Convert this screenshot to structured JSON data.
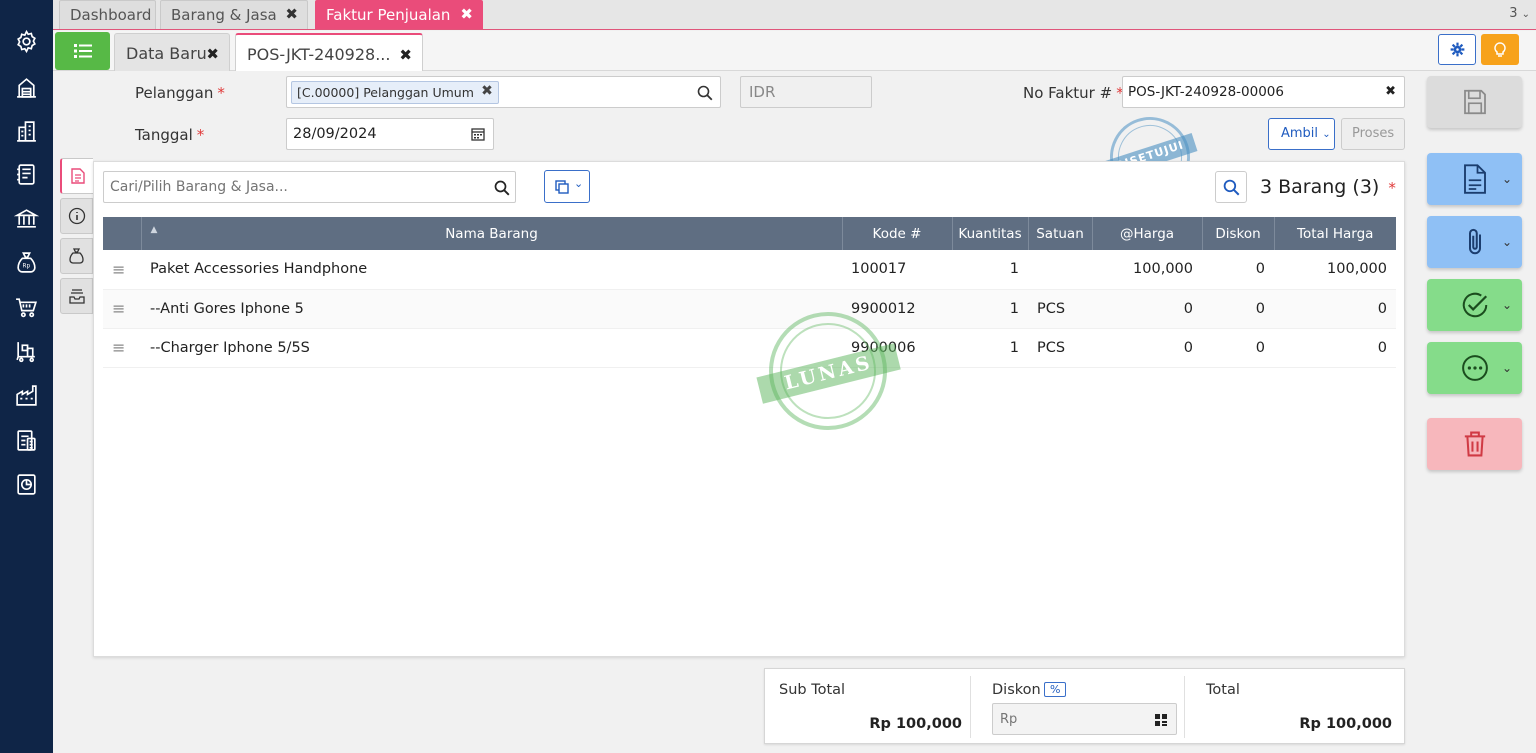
{
  "window_tabs": [
    {
      "label": "Dashboard",
      "closable": false,
      "active": false
    },
    {
      "label": "Barang & Jasa",
      "closable": true,
      "active": false
    },
    {
      "label": "Faktur Penjualan",
      "closable": true,
      "active": true
    }
  ],
  "tab_count": "3",
  "sub_tabs": [
    {
      "label": "Data Baru",
      "active": false
    },
    {
      "label": "POS-JKT-240928...",
      "active": true
    }
  ],
  "form": {
    "pelanggan_label": "Pelanggan",
    "pelanggan_value": "[C.00000] Pelanggan Umum",
    "currency": "IDR",
    "tanggal_label": "Tanggal",
    "tanggal_value": "28/09/2024",
    "no_faktur_label": "No Faktur #",
    "no_faktur_value": "POS-JKT-240928-00006",
    "required_mark": "*",
    "ambil_label": "Ambil",
    "proses_label": "Proses"
  },
  "items": {
    "search_placeholder": "Cari/Pilih Barang & Jasa...",
    "count_label": "3 Barang (3)",
    "columns": [
      "Nama Barang",
      "Kode #",
      "Kuantitas",
      "Satuan",
      "@Harga",
      "Diskon",
      "Total Harga"
    ],
    "rows": [
      {
        "nama": "Paket Accessories Handphone",
        "kode": "100017",
        "qty": "1",
        "satuan": "",
        "harga": "100,000",
        "diskon": "0",
        "total": "100,000"
      },
      {
        "nama": "--Anti Gores Iphone 5",
        "kode": "9900012",
        "qty": "1",
        "satuan": "PCS",
        "harga": "0",
        "diskon": "0",
        "total": "0"
      },
      {
        "nama": "--Charger Iphone 5/5S",
        "kode": "9900006",
        "qty": "1",
        "satuan": "PCS",
        "harga": "0",
        "diskon": "0",
        "total": "0"
      }
    ]
  },
  "stamps": {
    "approved": "DISETUJUI",
    "paid": "LUNAS"
  },
  "summary": {
    "subtotal_label": "Sub Total",
    "subtotal_value": "Rp 100,000",
    "diskon_label": "Diskon",
    "diskon_unit": "%",
    "diskon_placeholder": "Rp",
    "total_label": "Total",
    "total_value": "Rp 100,000"
  },
  "colors": {
    "sidebar": "#0f2547",
    "accent_pink": "#ea4c7a",
    "menu_green": "#57b946",
    "header_gray": "#5f6e82",
    "stamp_green": "#59b35a",
    "stamp_blue": "#4a90c2"
  },
  "sidebar_icons": [
    "gear-icon",
    "warehouse-icon",
    "building-icon",
    "ledger-icon",
    "bank-icon",
    "money-bag-icon",
    "cart-icon",
    "trolley-icon",
    "factory-icon",
    "tax-icon",
    "report-icon"
  ],
  "right_actions": [
    "save-icon",
    "document-icon",
    "paperclip-icon",
    "check-circle-icon",
    "more-circle-icon",
    "trash-icon"
  ]
}
